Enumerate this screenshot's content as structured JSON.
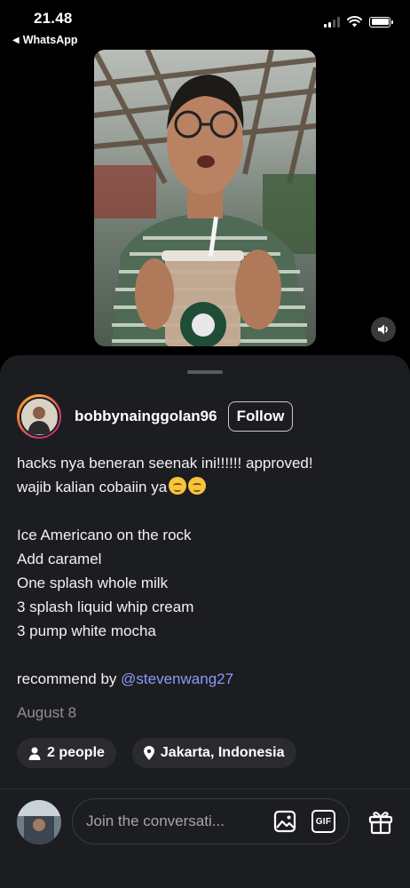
{
  "status_bar": {
    "time": "21.48",
    "back_app": "WhatsApp"
  },
  "post": {
    "username": "bobbynainggolan96",
    "follow_label": "Follow",
    "caption": {
      "line1": "hacks nya beneran seenak ini!!!!!! approved!",
      "line2": "wajib kalian cobaiin ya",
      "items": [
        "Ice Americano on the rock",
        "Add caramel",
        "One splash whole milk",
        "3 splash liquid whip cream",
        "3 pump white mocha"
      ],
      "recommend_prefix": "recommend by ",
      "mention": "@stevenwang27"
    },
    "date": "August 8",
    "people_label": "2 people",
    "location_label": "Jakarta, Indonesia"
  },
  "composer": {
    "placeholder": "Join the conversati...",
    "gif_label": "GIF"
  },
  "icons": [
    "back-triangle-icon",
    "signal-icon",
    "wifi-icon",
    "battery-icon",
    "speaker-icon",
    "person-icon",
    "location-pin-icon",
    "image-icon",
    "gif-icon",
    "gift-icon"
  ]
}
